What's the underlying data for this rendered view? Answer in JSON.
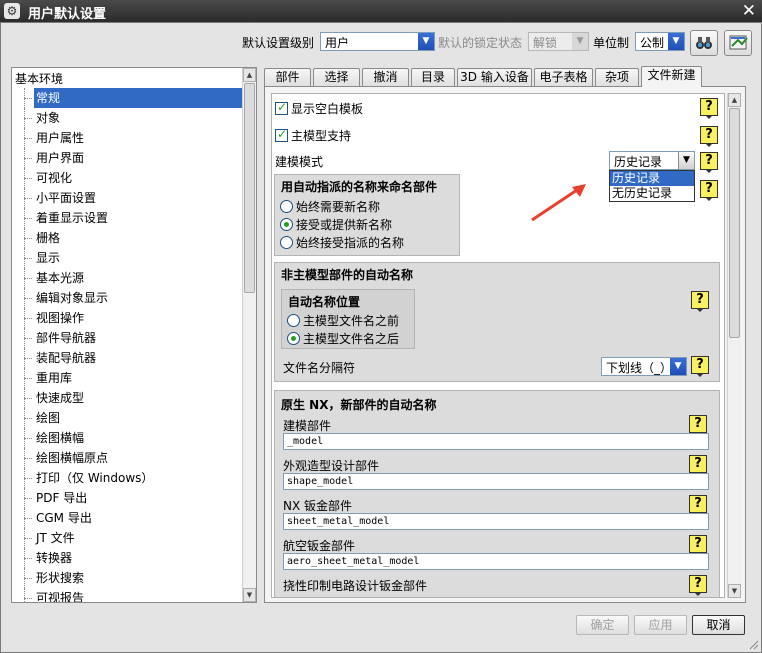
{
  "window": {
    "title": "用户默认设置"
  },
  "toolbar": {
    "level_label": "默认设置级别",
    "level_value": "用户",
    "lock_label": "默认的锁定状态",
    "lock_value": "解锁",
    "unit_label": "单位制",
    "unit_value": "公制"
  },
  "tree": {
    "root": "基本环境",
    "items": [
      "常规",
      "对象",
      "用户属性",
      "用户界面",
      "可视化",
      "小平面设置",
      "着重显示设置",
      "栅格",
      "显示",
      "基本光源",
      "编辑对象显示",
      "视图操作",
      "部件导航器",
      "装配导航器",
      "重用库",
      "快速成型",
      "绘图",
      "绘图横幅",
      "绘图横幅原点",
      "打印（仅 Windows）",
      "PDF 导出",
      "CGM 导出",
      "JT 文件",
      "转换器",
      "形状搜索",
      "可视报告"
    ],
    "selected_index": 0
  },
  "tabs": [
    "部件",
    "选择",
    "撤消",
    "目录",
    "3D 输入设备",
    "电子表格",
    "杂项",
    "文件新建"
  ],
  "active_tab": 7,
  "content": {
    "show_blank_template": "显示空白模板",
    "master_model_support": "主模型支持",
    "modeling_mode_label": "建模模式",
    "modeling_mode_value": "历史记录",
    "modeling_mode_options": [
      "历史记录",
      "无历史记录"
    ],
    "auto_name_group": {
      "title": "用自动指派的名称来命名部件",
      "options": [
        "始终需要新名称",
        "接受或提供新名称",
        "始终接受指派的名称"
      ],
      "selected": 1
    },
    "non_master_group": {
      "title": "非主模型部件的自动名称",
      "position_title": "自动名称位置",
      "position_options": [
        "主模型文件名之前",
        "主模型文件名之后"
      ],
      "position_selected": 1,
      "separator_label": "文件名分隔符",
      "separator_value": "下划线（_）"
    },
    "native_group": {
      "title": "原生 NX，新部件的自动名称",
      "fields": [
        {
          "label": "建模部件",
          "value": "_model"
        },
        {
          "label": "外观造型设计部件",
          "value": "shape_model"
        },
        {
          "label": "NX 钣金部件",
          "value": "sheet_metal_model"
        },
        {
          "label": "航空钣金部件",
          "value": "aero_sheet_metal_model"
        },
        {
          "label": "挠性印制电路设计钣金部件",
          "value": ""
        }
      ]
    }
  },
  "buttons": {
    "ok": "确定",
    "apply": "应用",
    "cancel": "取消"
  },
  "colors": {
    "selection": "#316ac5",
    "help_icon": "#f8f060",
    "annotation_arrow": "#e8402c"
  }
}
